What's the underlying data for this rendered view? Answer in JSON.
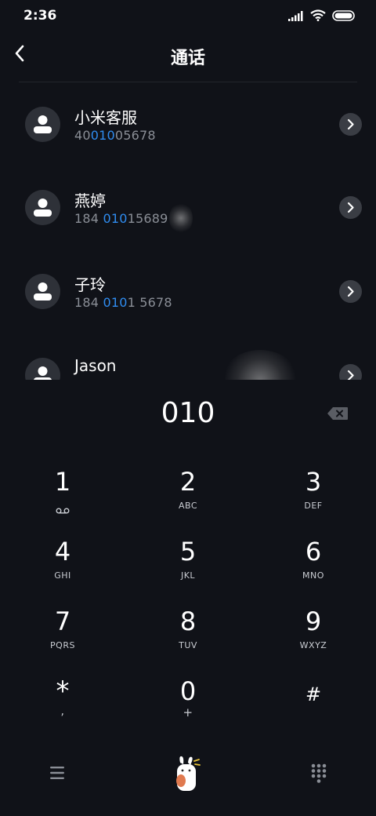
{
  "status_bar": {
    "time": "2:36"
  },
  "header": {
    "title": "通话"
  },
  "contacts": [
    {
      "name": "小米客服",
      "number_pre": "40",
      "number_match": "010",
      "number_post": "05678"
    },
    {
      "name": "燕婷",
      "number_pre": "184 ",
      "number_match": "010",
      "number_post": "15689"
    },
    {
      "name": "子玲",
      "number_pre": "184 ",
      "number_match": "010",
      "number_post": "1 5678"
    },
    {
      "name": "Jason",
      "number_pre": "",
      "number_match": "",
      "number_post": ""
    }
  ],
  "dialer": {
    "input_value": "010"
  },
  "keypad": {
    "keys": [
      {
        "digit": "1",
        "letters": ""
      },
      {
        "digit": "2",
        "letters": "ABC"
      },
      {
        "digit": "3",
        "letters": "DEF"
      },
      {
        "digit": "4",
        "letters": "GHI"
      },
      {
        "digit": "5",
        "letters": "JKL"
      },
      {
        "digit": "6",
        "letters": "MNO"
      },
      {
        "digit": "7",
        "letters": "PQRS"
      },
      {
        "digit": "8",
        "letters": "TUV"
      },
      {
        "digit": "9",
        "letters": "WXYZ"
      },
      {
        "digit": "*",
        "letters": ","
      },
      {
        "digit": "0",
        "letters": "+"
      },
      {
        "digit": "#",
        "letters": ""
      }
    ]
  },
  "icons": {
    "back": "chevron-left-icon",
    "delete": "backspace-icon",
    "voicemail": "voicemail-icon",
    "menu": "hamburger-menu-icon",
    "mascot": "rabbit-mascot-icon",
    "dialpad": "dialpad-icon"
  },
  "colors": {
    "background": "#101218",
    "highlight": "#2f8cf0",
    "avatar": "#2e3138",
    "muted_text": "#8a8e96"
  }
}
